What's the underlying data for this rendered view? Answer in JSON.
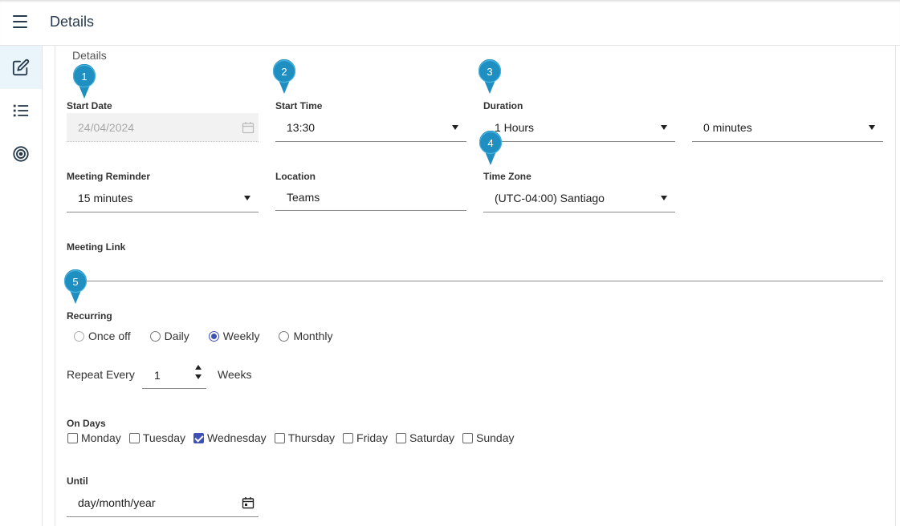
{
  "header": {
    "title": "Details",
    "menu_icon": "hamburger-menu-icon"
  },
  "sidebar": {
    "items": [
      {
        "icon": "edit-icon",
        "active": true
      },
      {
        "icon": "list-icon",
        "active": false
      },
      {
        "icon": "target-icon",
        "active": false
      }
    ]
  },
  "section_title": "Details",
  "markers": [
    "1",
    "2",
    "3",
    "4",
    "5"
  ],
  "form": {
    "start_date": {
      "label": "Start Date",
      "value": "24/04/2024"
    },
    "start_time": {
      "label": "Start Time",
      "value": "13:30"
    },
    "duration": {
      "label": "Duration",
      "hours_value": "1 Hours",
      "minutes_value": "0 minutes"
    },
    "meeting_reminder": {
      "label": "Meeting Reminder",
      "value": "15 minutes"
    },
    "location": {
      "label": "Location",
      "value": "Teams"
    },
    "time_zone": {
      "label": "Time Zone",
      "value": "(UTC-04:00) Santiago"
    },
    "meeting_link": {
      "label": "Meeting Link",
      "value": ""
    },
    "recurring": {
      "label": "Recurring",
      "options": [
        "Once off",
        "Daily",
        "Weekly",
        "Monthly"
      ],
      "selected": "Weekly"
    },
    "repeat": {
      "label": "Repeat Every",
      "value": "1",
      "unit": "Weeks"
    },
    "on_days": {
      "label": "On Days",
      "days": [
        "Monday",
        "Tuesday",
        "Wednesday",
        "Thursday",
        "Friday",
        "Saturday",
        "Sunday"
      ],
      "checked": [
        "Wednesday"
      ]
    },
    "until": {
      "label": "Until",
      "placeholder": "day/month/year"
    }
  },
  "colors": {
    "accent": "#3f51b5",
    "marker": "#1e8fc0",
    "header_text": "#263a4d"
  }
}
